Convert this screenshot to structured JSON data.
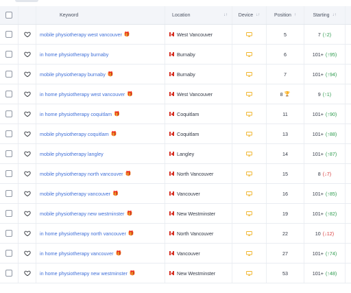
{
  "table": {
    "headers": {
      "keyword": "Keyword",
      "location": "Location",
      "device": "Device",
      "position": "Position",
      "starting": "Starting"
    },
    "rows": [
      {
        "keyword": "mobile physiotherapy west vancouver",
        "gift": true,
        "location": "West Vancouver",
        "position": "5",
        "trophy": false,
        "starting": "7",
        "change": "(↑2)",
        "dir": "up"
      },
      {
        "keyword": "in home physiotherapy burnaby",
        "gift": false,
        "location": "Burnaby",
        "position": "6",
        "trophy": false,
        "starting": "101+",
        "change": "(↑95)",
        "dir": "up"
      },
      {
        "keyword": "mobile physiotherapy burnaby",
        "gift": true,
        "location": "Burnaby",
        "position": "7",
        "trophy": false,
        "starting": "101+",
        "change": "(↑94)",
        "dir": "up"
      },
      {
        "keyword": "in home physiotherapy west vancouver",
        "gift": true,
        "location": "West Vancouver",
        "position": "8",
        "trophy": true,
        "starting": "9",
        "change": "(↑1)",
        "dir": "up"
      },
      {
        "keyword": "in home physiotherapy coquitlam",
        "gift": true,
        "location": "Coquitlam",
        "position": "11",
        "trophy": false,
        "starting": "101+",
        "change": "(↑90)",
        "dir": "up"
      },
      {
        "keyword": "mobile physiotherapy coquitlam",
        "gift": true,
        "location": "Coquitlam",
        "position": "13",
        "trophy": false,
        "starting": "101+",
        "change": "(↑88)",
        "dir": "up"
      },
      {
        "keyword": "mobile physiotherapy langley",
        "gift": false,
        "location": "Langley",
        "position": "14",
        "trophy": false,
        "starting": "101+",
        "change": "(↑87)",
        "dir": "up"
      },
      {
        "keyword": "mobile physiotherapy north vancouver",
        "gift": true,
        "location": "North Vancouver",
        "position": "15",
        "trophy": false,
        "starting": "8",
        "change": "(↓7)",
        "dir": "down"
      },
      {
        "keyword": "mobile physiotherapy vancouver",
        "gift": true,
        "location": "Vancouver",
        "position": "16",
        "trophy": false,
        "starting": "101+",
        "change": "(↑85)",
        "dir": "up"
      },
      {
        "keyword": "mobile physiotherapy new westminster",
        "gift": true,
        "location": "New Westminster",
        "position": "19",
        "trophy": false,
        "starting": "101+",
        "change": "(↑82)",
        "dir": "up"
      },
      {
        "keyword": "in home physiotherapy north vancouver",
        "gift": true,
        "location": "North Vancouver",
        "position": "22",
        "trophy": false,
        "starting": "10",
        "change": "(↓12)",
        "dir": "down"
      },
      {
        "keyword": "in home physiotherapy vancouver",
        "gift": true,
        "location": "Vancouver",
        "position": "27",
        "trophy": false,
        "starting": "101+",
        "change": "(↑74)",
        "dir": "up"
      },
      {
        "keyword": "in home physiotherapy new westminster",
        "gift": true,
        "location": "New Westminster",
        "position": "53",
        "trophy": false,
        "starting": "101+",
        "change": "(↑48)",
        "dir": "up"
      }
    ]
  },
  "icons": {
    "favorite": "heart-outline-icon",
    "device": "desktop-monitor-icon",
    "keyword_marker": "gift-icon",
    "rank_marker": "trophy-icon",
    "location_flag": "canada-flag-icon"
  },
  "colors": {
    "keyword_link": "#3f6fd8",
    "gift": "#d82c2c",
    "monitor": "#f0b429",
    "change_up": "#2e9b4e",
    "change_down": "#d83a3a",
    "header_bg": "#f3f5f9"
  }
}
